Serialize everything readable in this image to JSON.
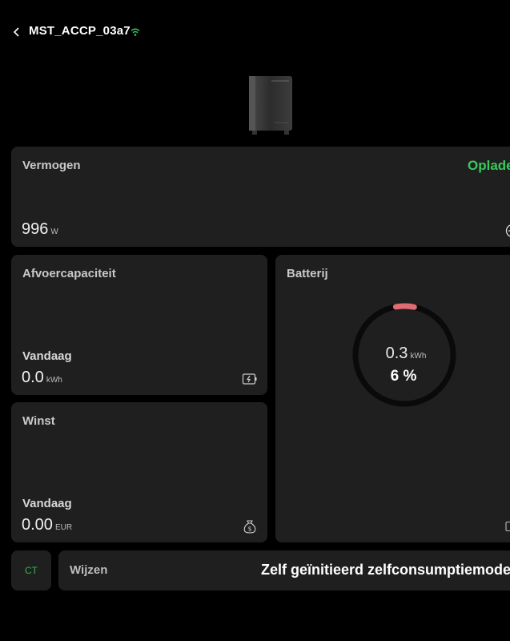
{
  "header": {
    "device_name": "MST_ACCP_03a7",
    "back_icon": "chevron-left-icon",
    "connection_icon": "wifi-icon",
    "connection_color": "#38c95a"
  },
  "device": {
    "image": "home-battery-unit-image"
  },
  "power": {
    "title": "Vermogen",
    "value": "996",
    "unit": "W",
    "status": "Opladen",
    "status_color": "#38c95a",
    "icon": "power-flow-icon"
  },
  "discharge": {
    "title": "Afvoercapaciteit",
    "period_label": "Vandaag",
    "value": "0.0",
    "unit": "kWh",
    "icon": "battery-charge-icon"
  },
  "profit": {
    "title": "Winst",
    "period_label": "Vandaag",
    "value": "0.00",
    "unit": "EUR",
    "icon": "money-bag-icon"
  },
  "battery": {
    "title": "Batterij",
    "energy_value": "0.3",
    "energy_unit": "kWh",
    "percent_label": "6 %",
    "level_percent": 6,
    "ring_color": "#e06b72"
  },
  "ct": {
    "label": "CT"
  },
  "mode": {
    "label": "Wijzen",
    "value": "Zelf geïnitieerd zelfconsumptiemodel"
  }
}
